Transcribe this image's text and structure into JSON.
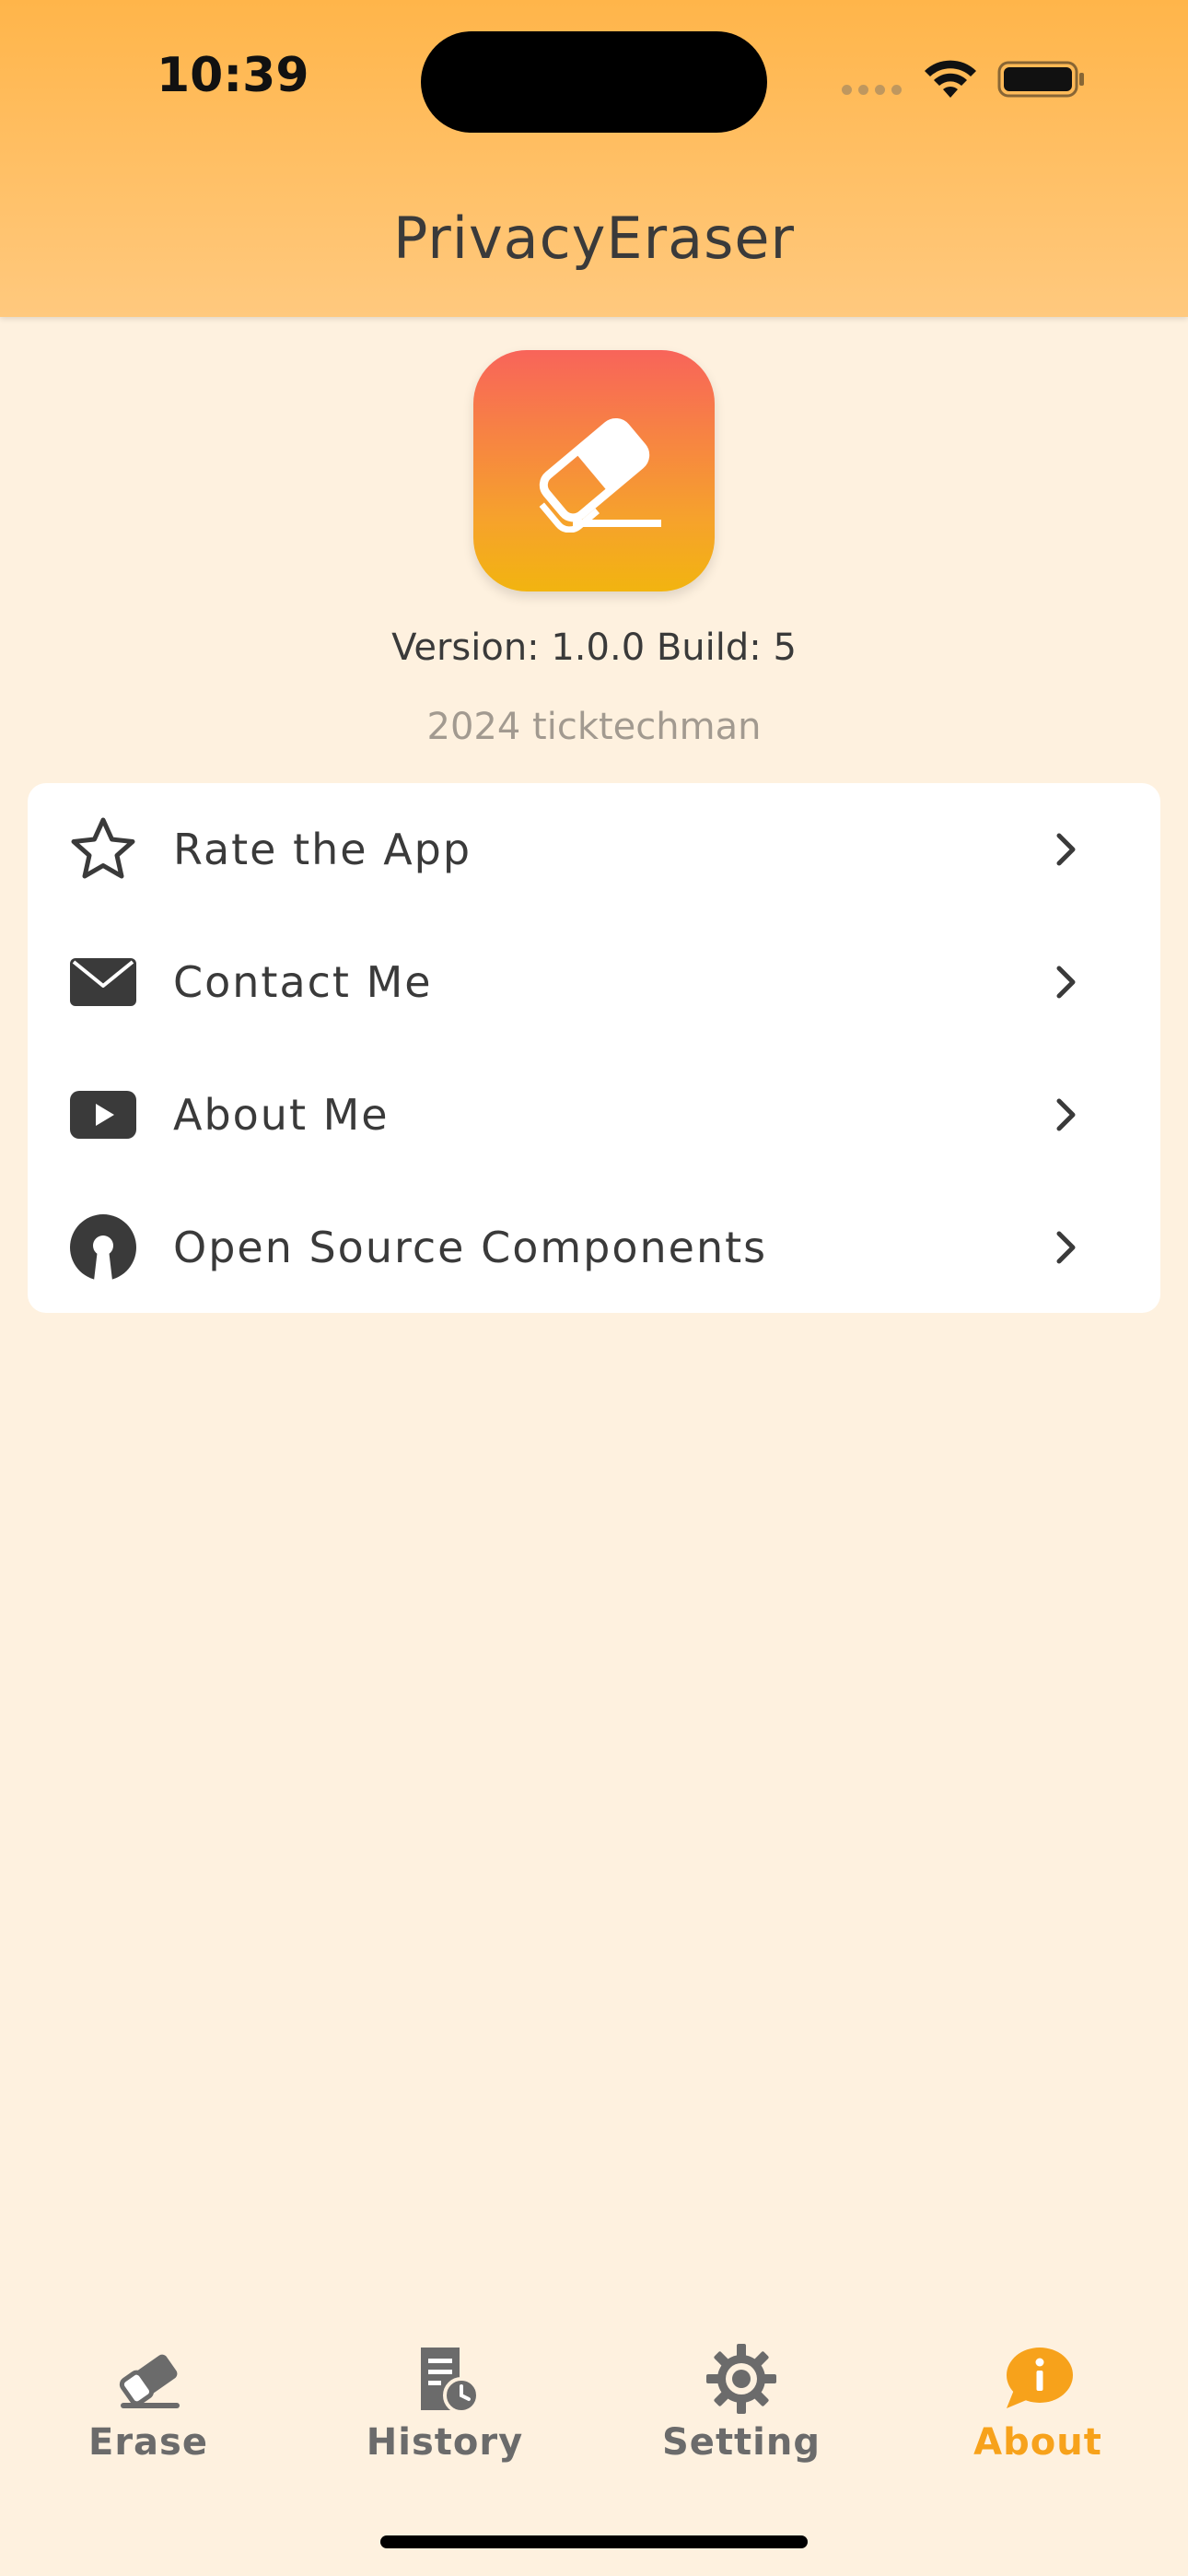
{
  "status_bar": {
    "time": "10:39"
  },
  "header": {
    "title": "PrivacyEraser"
  },
  "app_info": {
    "version": "Version: 1.0.0 Build: 5",
    "copyright": "2024 ticktechman"
  },
  "menu": {
    "items": [
      {
        "label": "Rate the App",
        "icon": "star-icon"
      },
      {
        "label": "Contact Me",
        "icon": "envelope-icon"
      },
      {
        "label": "About Me",
        "icon": "youtube-icon"
      },
      {
        "label": "Open Source Components",
        "icon": "open-source-icon"
      }
    ]
  },
  "tabs": [
    {
      "label": "Erase",
      "icon": "eraser-icon",
      "active": false
    },
    {
      "label": "History",
      "icon": "history-icon",
      "active": false
    },
    {
      "label": "Setting",
      "icon": "gear-icon",
      "active": false
    },
    {
      "label": "About",
      "icon": "info-icon",
      "active": true
    }
  ],
  "colors": {
    "accent": "#F7A21B",
    "background": "#FEF1DF",
    "header_top": "#FFB54A",
    "header_bottom": "#FFC97E"
  }
}
